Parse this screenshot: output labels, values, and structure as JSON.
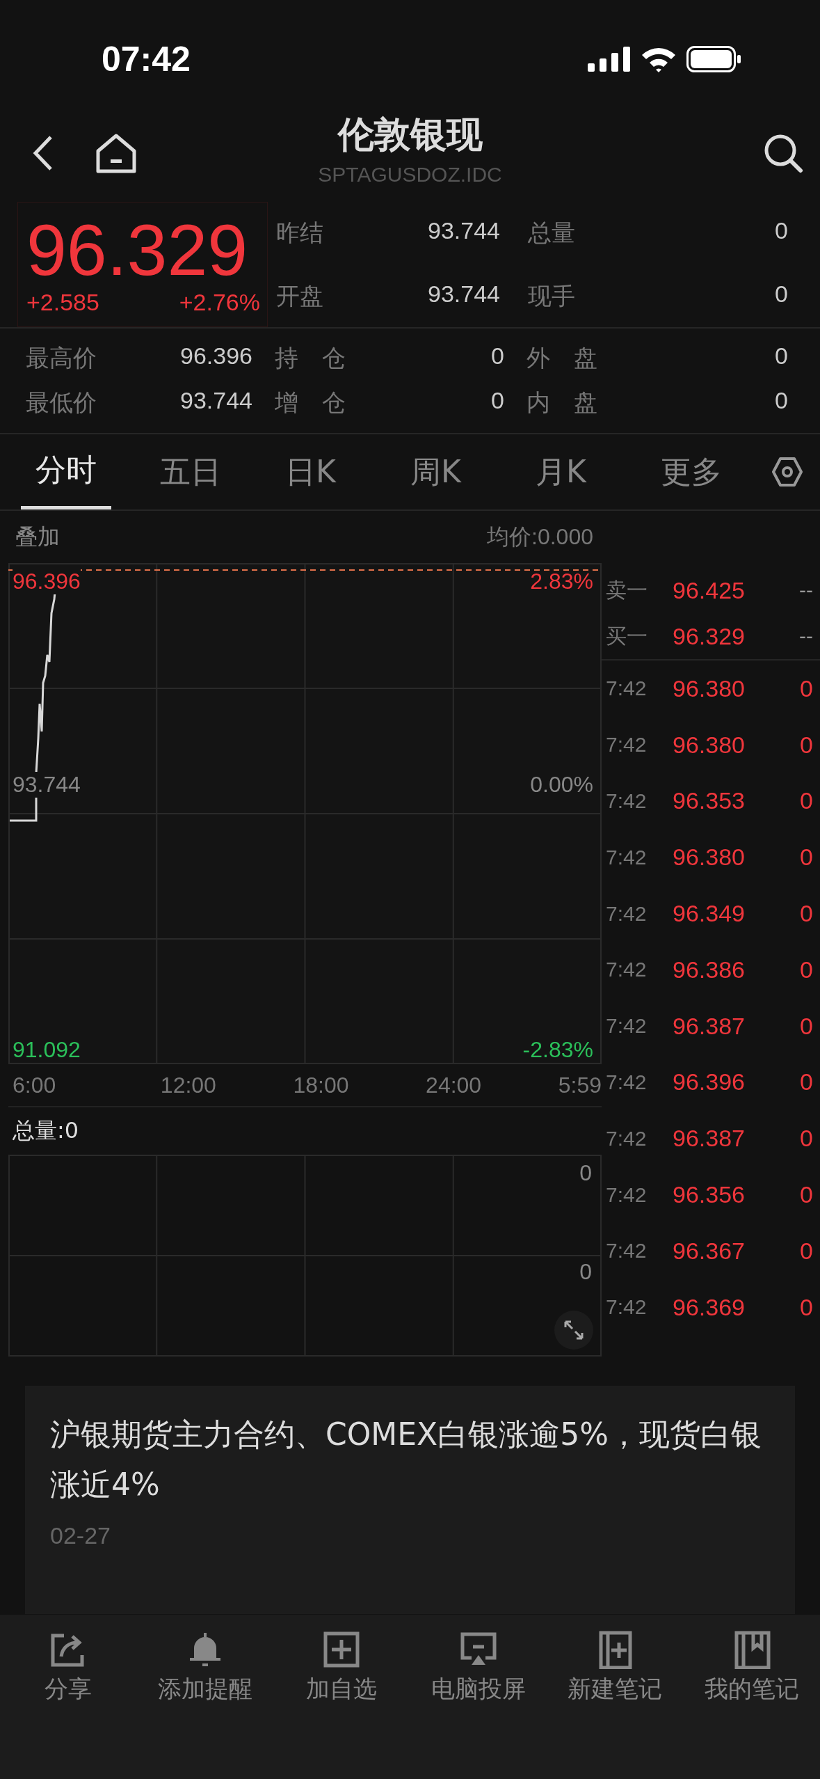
{
  "status_bar": {
    "time": "07:42"
  },
  "header": {
    "title": "伦敦银现",
    "subtitle": "SPTAGUSDOZ.IDC"
  },
  "quote": {
    "price": "96.329",
    "change": "+2.585",
    "change_pct": "+2.76%"
  },
  "quote_stats": [
    {
      "label": "昨结",
      "value": "93.744"
    },
    {
      "label": "总量",
      "value": "0"
    },
    {
      "label": "开盘",
      "value": "93.744"
    },
    {
      "label": "现手",
      "value": "0"
    }
  ],
  "detail_stats": [
    {
      "label": "最高价",
      "value": "96.396"
    },
    {
      "label": "持　仓",
      "value": "0"
    },
    {
      "label": "外　盘",
      "value": "0"
    },
    {
      "label": "最低价",
      "value": "93.744"
    },
    {
      "label": "增　仓",
      "value": "0"
    },
    {
      "label": "内　盘",
      "value": "0"
    }
  ],
  "tabs": [
    {
      "label": "分时",
      "selected": true
    },
    {
      "label": "五日",
      "selected": false
    },
    {
      "label": "日K",
      "selected": false
    },
    {
      "label": "周K",
      "selected": false
    },
    {
      "label": "月K",
      "selected": false
    },
    {
      "label": "更多",
      "selected": false
    }
  ],
  "chart": {
    "overlay_label": "叠加",
    "avg_price": "均价:0.000",
    "top_price": "96.396",
    "top_pct": "2.83%",
    "mid_price": "93.744",
    "mid_pct": "0.00%",
    "low_price": "91.092",
    "low_pct": "-2.83%",
    "time_labels": [
      "6:00",
      "12:00",
      "18:00",
      "24:00",
      "5:59"
    ]
  },
  "volume": {
    "total": "总量:0",
    "top_value": "0",
    "mid_value": "0"
  },
  "order_book": [
    {
      "label": "卖一",
      "price": "96.425",
      "volume": "--"
    },
    {
      "label": "买一",
      "price": "96.329",
      "volume": "--"
    }
  ],
  "trades": [
    {
      "time": "7:42",
      "price": "96.380",
      "volume": "0"
    },
    {
      "time": "7:42",
      "price": "96.380",
      "volume": "0"
    },
    {
      "time": "7:42",
      "price": "96.353",
      "volume": "0"
    },
    {
      "time": "7:42",
      "price": "96.380",
      "volume": "0"
    },
    {
      "time": "7:42",
      "price": "96.349",
      "volume": "0"
    },
    {
      "time": "7:42",
      "price": "96.386",
      "volume": "0"
    },
    {
      "time": "7:42",
      "price": "96.387",
      "volume": "0"
    },
    {
      "time": "7:42",
      "price": "96.396",
      "volume": "0"
    },
    {
      "time": "7:42",
      "price": "96.387",
      "volume": "0"
    },
    {
      "time": "7:42",
      "price": "96.356",
      "volume": "0"
    },
    {
      "time": "7:42",
      "price": "96.367",
      "volume": "0"
    },
    {
      "time": "7:42",
      "price": "96.369",
      "volume": "0"
    }
  ],
  "news": [
    {
      "title": "沪银期货主力合约、COMEX白银涨逾5%，现货白银涨近4%",
      "date": "02-27"
    }
  ],
  "toolbar": [
    {
      "label": "分享"
    },
    {
      "label": "添加提醒"
    },
    {
      "label": "加自选"
    },
    {
      "label": "电脑投屏"
    },
    {
      "label": "新建笔记"
    },
    {
      "label": "我的笔记"
    }
  ]
}
